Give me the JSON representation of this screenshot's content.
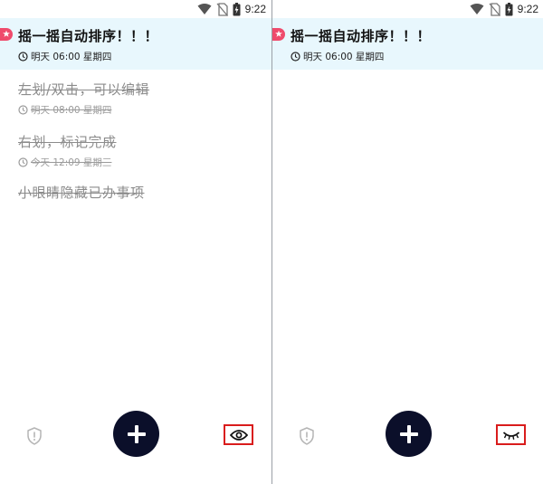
{
  "status_bar": {
    "time": "9:22",
    "icons": [
      "wifi-icon",
      "no-sim-icon",
      "battery-charging-icon"
    ]
  },
  "left_screen": {
    "pinned_task": {
      "title": "摇一摇自动排序！！！",
      "time": "明天 06:00 星期四",
      "icon": "star-badge-icon"
    },
    "completed_tasks": [
      {
        "title": "左划/双击，可以编辑",
        "time": "明天 08:00 星期四"
      },
      {
        "title": "右划，标记完成",
        "time": "今天 12:09 星期三"
      },
      {
        "title": "小眼睛隐藏已办事项",
        "time": ""
      }
    ],
    "toolbar": {
      "left_icon": "shield-alert-icon",
      "fab_icon": "plus-icon",
      "right_icon": "eye-open-icon",
      "highlight_color": "#d91c1c"
    }
  },
  "right_screen": {
    "pinned_task": {
      "title": "摇一摇自动排序！！！",
      "time": "明天 06:00 星期四",
      "icon": "star-badge-icon"
    },
    "toolbar": {
      "left_icon": "shield-alert-icon",
      "fab_icon": "plus-icon",
      "right_icon": "eye-closed-icon",
      "highlight_color": "#d91c1c"
    }
  },
  "colors": {
    "pinned_background": "#e8f7fd",
    "fab": "#0b0f2a",
    "star_badge": "#ef4b6c",
    "completed_text": "#8c8c8c"
  }
}
